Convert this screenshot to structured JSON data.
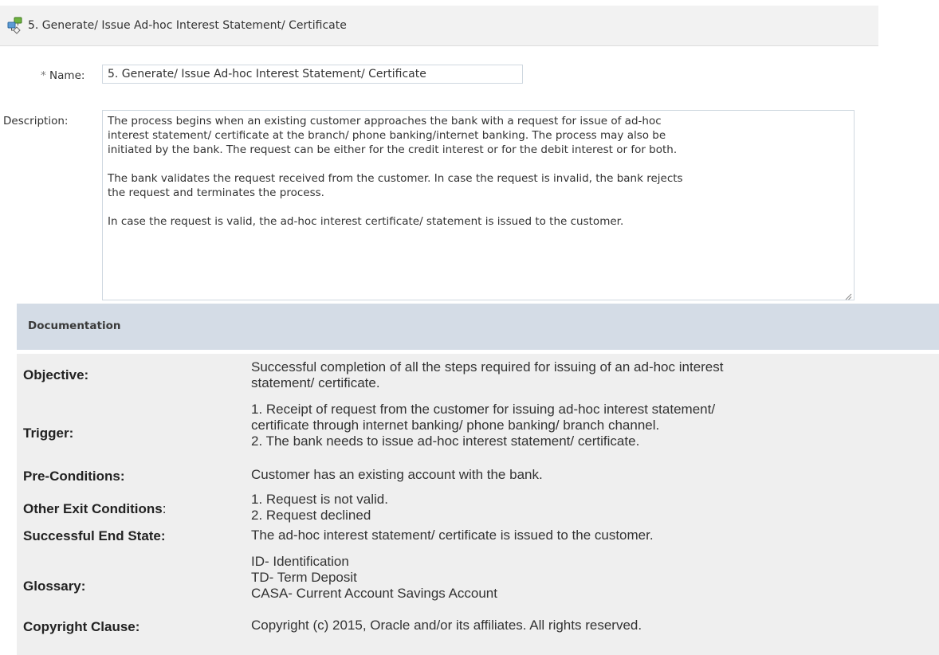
{
  "header": {
    "title": "5. Generate/ Issue Ad-hoc Interest Statement/ Certificate",
    "icon": "process-flow-icon"
  },
  "form": {
    "name_required_mark": "*",
    "name_label": "Name:",
    "name_value": "5. Generate/ Issue Ad-hoc Interest Statement/ Certificate",
    "description_label": "Description:",
    "description_paragraphs": [
      [
        "The process begins when an existing customer approaches the bank with a request for issue of ad-hoc",
        "interest statement/ certificate at the branch/ phone banking/internet banking. The process may also be",
        "initiated by the bank. The request can be either for the credit interest or for the debit interest or for both."
      ],
      [
        "The bank validates the request received from the customer. In case the request is invalid, the bank rejects",
        "the request and terminates the process."
      ],
      [
        "In case the request is valid, the ad-hoc interest certificate/ statement is issued to the customer."
      ]
    ]
  },
  "documentation": {
    "title": "Documentation",
    "rows": [
      {
        "key": "Objective:",
        "lines": [
          "Successful completion of all the steps required for issuing of an ad-hoc interest",
          "statement/ certificate."
        ]
      },
      {
        "key": "Trigger:",
        "lines": [
          "1. Receipt of request from the customer for issuing ad-hoc interest statement/",
          "certificate through internet banking/ phone banking/ branch channel.",
          "2. The bank needs to issue ad-hoc interest statement/ certificate."
        ]
      },
      {
        "key": "Pre-Conditions:",
        "lines": [
          "Customer has an existing account with the bank."
        ]
      },
      {
        "key": "Other Exit Conditions",
        "key_suffix": ":",
        "lines": [
          "1. Request is not valid.",
          "2. Request declined"
        ]
      },
      {
        "key": "Successful End State:",
        "lines": [
          "The ad-hoc interest statement/ certificate is issued to the customer."
        ]
      },
      {
        "key": "Glossary:",
        "lines": [
          "ID- Identification",
          "TD- Term Deposit",
          "CASA- Current Account Savings Account"
        ]
      },
      {
        "key": "Copyright Clause:",
        "lines": [
          "Copyright (c) 2015, Oracle and/or its affiliates. All rights reserved."
        ]
      }
    ]
  },
  "colors": {
    "header_bg": "#f2f2f2",
    "doc_header_bg": "#d4dce6",
    "doc_body_bg": "#efefef",
    "input_border": "#cfd8e0"
  }
}
